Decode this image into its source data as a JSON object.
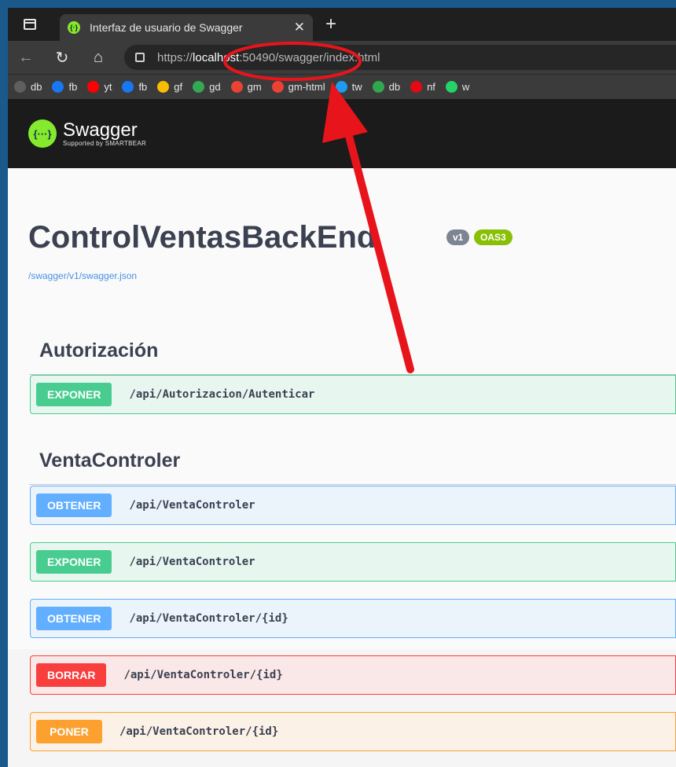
{
  "browser": {
    "tab_title": "Interfaz de usuario de Swagger",
    "close_glyph": "✕",
    "new_tab_glyph": "+",
    "url_prefix": "https://",
    "url_host": "localhost",
    "url_rest": ":50490/swagger/index.html",
    "bookmarks": [
      {
        "label": "db",
        "icon": "page-icon",
        "color": "#5f5f5f"
      },
      {
        "label": "fb",
        "icon": "facebook-icon",
        "color": "#1877f2"
      },
      {
        "label": "yt",
        "icon": "youtube-icon",
        "color": "#ff0000"
      },
      {
        "label": "fb",
        "icon": "facebook-icon",
        "color": "#1877f2"
      },
      {
        "label": "gf",
        "icon": "google-photos-icon",
        "color": "#fbbc04"
      },
      {
        "label": "gd",
        "icon": "google-drive-icon",
        "color": "#34a853"
      },
      {
        "label": "gm",
        "icon": "gmail-icon",
        "color": "#ea4335"
      },
      {
        "label": "gm-html",
        "icon": "gmail-icon",
        "color": "#ea4335"
      },
      {
        "label": "tw",
        "icon": "twitter-icon",
        "color": "#1d9bf0"
      },
      {
        "label": "db",
        "icon": "z-icon",
        "color": "#2fa84f"
      },
      {
        "label": "nf",
        "icon": "netflix-icon",
        "color": "#e50914"
      },
      {
        "label": "w",
        "icon": "whatsapp-icon",
        "color": "#25d366"
      }
    ]
  },
  "swagger": {
    "logo_glyph": "{···}",
    "brand": "Swagger",
    "brand_sub": "Supported by SMARTBEAR",
    "title": "ControlVentasBackEnd",
    "version_badge": "v1",
    "oas_badge": "OAS3",
    "spec_link": "/swagger/v1/swagger.json",
    "sections": [
      {
        "name": "Autorización",
        "operations": [
          {
            "method": "EXPONER",
            "kind": "post",
            "path": "/api/Autorizacion/Autenticar"
          }
        ]
      },
      {
        "name": "VentaControler",
        "operations": [
          {
            "method": "OBTENER",
            "kind": "get",
            "path": "/api/VentaControler"
          },
          {
            "method": "EXPONER",
            "kind": "post",
            "path": "/api/VentaControler"
          },
          {
            "method": "OBTENER",
            "kind": "get",
            "path": "/api/VentaControler/{id}"
          },
          {
            "method": "BORRAR",
            "kind": "delete",
            "path": "/api/VentaControler/{id}"
          },
          {
            "method": "PONER",
            "kind": "put",
            "path": "/api/VentaControler/{id}"
          }
        ]
      }
    ]
  },
  "colors": {
    "annotation": "#e8141b",
    "swagger_green": "#85ea2d",
    "get": "#61affe",
    "post": "#49cc90",
    "delete": "#f93e3e",
    "put": "#fca130"
  }
}
